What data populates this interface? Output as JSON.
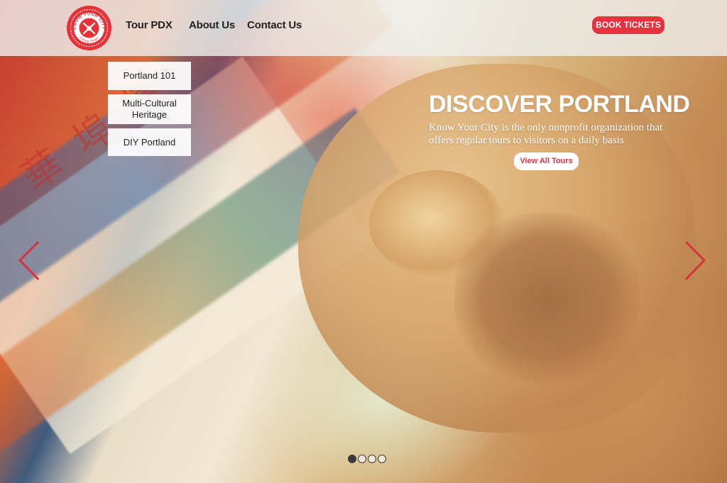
{
  "header": {
    "logo_alt": "Know Your City",
    "logo_text": {
      "top": "KNOW YOUR CITY",
      "bottom": "Portland, Oregon"
    },
    "nav": [
      {
        "label": "Tour PDX"
      },
      {
        "label": "About Us"
      },
      {
        "label": "Contact Us"
      }
    ],
    "book_label": "BOOK TICKETS"
  },
  "dropdown": {
    "items": [
      {
        "label": "Portland 101"
      },
      {
        "label": "Multi-Cultural Heritage"
      },
      {
        "label": "DIY Portland"
      }
    ]
  },
  "hero": {
    "title": "DISCOVER PORTLAND",
    "description": "Know Your City is the only nonprofit organization that offers regular tours to visitors on a daily basis",
    "cta_label": "View All Tours",
    "background_glyphs": "華 埠 博"
  },
  "slider": {
    "prev_icon": "chevron-left-icon",
    "next_icon": "chevron-right-icon",
    "slide_count": 4,
    "active_index": 0
  },
  "colors": {
    "accent": "#e7313f",
    "nav_text": "#222222",
    "header_bg": "#eeeeec"
  }
}
